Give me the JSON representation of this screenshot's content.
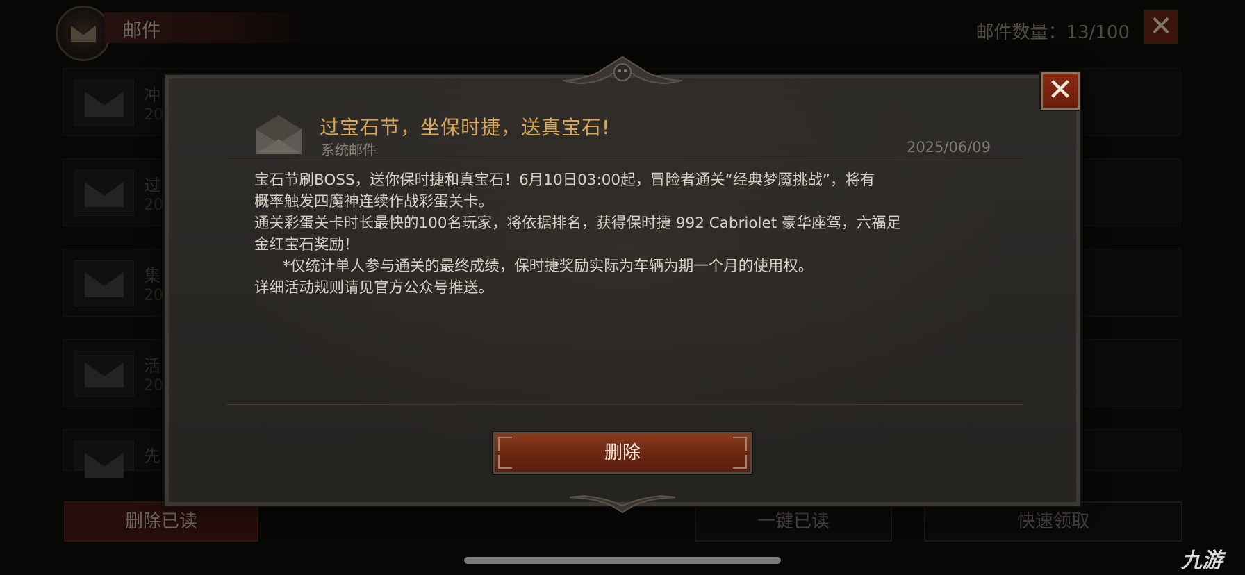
{
  "background": {
    "header_title": "邮件",
    "mail_count": "邮件数量：13/100",
    "close_label": "✕",
    "mail_items": [
      {
        "title": "冲",
        "date": "20"
      },
      {
        "title": "过",
        "date": "20"
      },
      {
        "title": "集",
        "date": "20"
      },
      {
        "title": "活",
        "date": "20"
      },
      {
        "title": "先",
        "date": ""
      }
    ],
    "buttons": {
      "delete_read": "删除已读",
      "mark_all_read": "一键已读",
      "quick_claim": "快速领取"
    },
    "watermark": "九游"
  },
  "modal": {
    "close_label": "✕",
    "title": "过宝石节，坐保时捷，送真宝石!",
    "sender": "系统邮件",
    "date": "2025/06/09",
    "body": [
      "宝石节刷BOSS，送你保时捷和真宝石！6月10日03:00起，冒险者通关“经典梦魇挑战”，将有",
      "概率触发四魔神连续作战彩蛋关卡。",
      "通关彩蛋关卡时长最快的100名玩家，将依据排名，获得保时捷 992 Cabriolet 豪华座驾，六福足",
      "金红宝石奖励！",
      "      *仅统计单人参与通关的最终成绩，保时捷奖励实际为车辆为期一个月的使用权。",
      "详细活动规则请见官方公众号推送。"
    ],
    "delete_label": "删除"
  },
  "colors": {
    "accent_title": "#d8a55a",
    "button_red": "#6a2612",
    "background": "#0c0b0a"
  }
}
